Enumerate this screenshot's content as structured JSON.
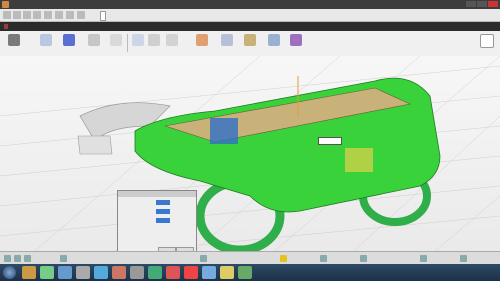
{
  "window": {
    "title": ""
  },
  "menubar": {
    "tab_label": ""
  },
  "ribbon": {
    "info_text": "",
    "highlight_text": ""
  },
  "panel": {
    "header": "",
    "rows": [
      "",
      "",
      "",
      "",
      ""
    ],
    "ok": "",
    "cancel": ""
  },
  "dimension": {
    "value": ""
  },
  "taskbar": {
    "clock": ""
  },
  "colors": {
    "model_green": "#39d23a",
    "panel_tan": "#c9b27a",
    "wheel_green": "#2fae4a",
    "accent_blue": "#2f6fc7"
  }
}
